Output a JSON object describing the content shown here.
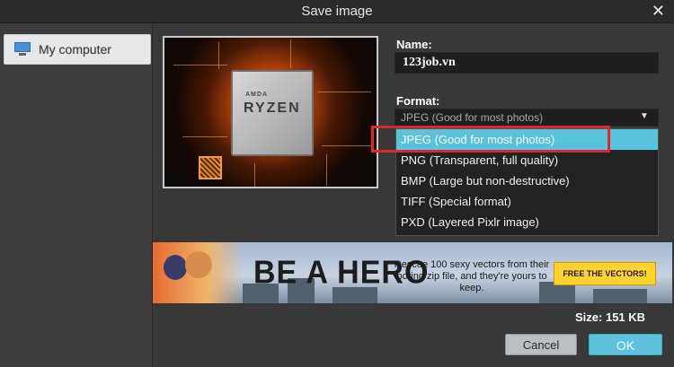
{
  "window": {
    "title": "Save image",
    "close_icon": "close-icon"
  },
  "sidebar": {
    "items": [
      {
        "label": "My computer",
        "icon": "monitor-icon",
        "selected": true
      }
    ]
  },
  "preview": {
    "chip_brand": "AMDA",
    "chip_name": "RYZEN"
  },
  "name": {
    "label": "Name:",
    "value": "123job.vn"
  },
  "format": {
    "label": "Format:",
    "selected": "JPEG (Good for most photos)",
    "options": [
      "JPEG (Good for most photos)",
      "PNG (Transparent, full quality)",
      "BMP (Large but non-destructive)",
      "TIFF (Special format)",
      "PXD (Layered Pixlr image)"
    ],
    "highlight_color": "#e0262b",
    "selected_color": "#57c3dc"
  },
  "banner": {
    "headline": "BE A HERO",
    "text": "Rescue 100 sexy vectors from their boring zip file, and they're yours to keep.",
    "cta": "FREE THE VECTORS!"
  },
  "size": {
    "label": "Size:",
    "value": "151 KB"
  },
  "buttons": {
    "cancel": "Cancel",
    "ok": "OK"
  },
  "colors": {
    "accent": "#5cc2dd",
    "background": "#383838"
  }
}
